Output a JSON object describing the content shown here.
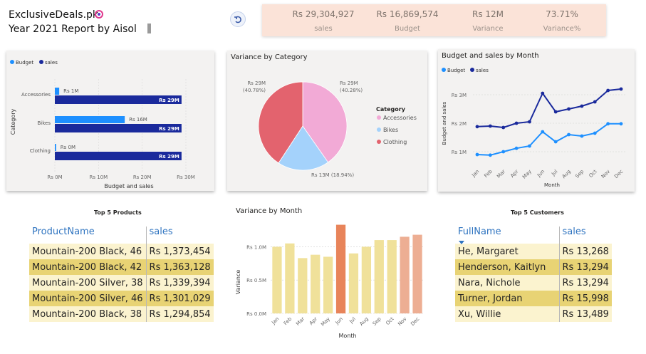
{
  "header": {
    "title": "ExclusiveDeals.pk",
    "subtitle": "Year 2021 Report by Aisol"
  },
  "kpis": [
    {
      "value": "Rs 29,304,927",
      "label": "sales"
    },
    {
      "value": "Rs 16,869,574",
      "label": "Budget"
    },
    {
      "value": "Rs 12M",
      "label": "Variance"
    },
    {
      "value": "73.71%",
      "label": "Variance%"
    }
  ],
  "colors": {
    "budget": "#1e90ff",
    "sales": "#1a2a9c",
    "kpi_bg": "#fbe3d8",
    "pie_accessories": "#f2aad6",
    "pie_bikes": "#a4d2fb",
    "pie_clothing": "#e3636e",
    "bar_light": "#f0e19a",
    "bar_dark": "#e8845a",
    "bar_mid": "#edae93",
    "row_light": "#fbf3cf",
    "row_dark": "#e8d374"
  },
  "chart_data": [
    {
      "type": "bar",
      "orientation": "horizontal",
      "title": "",
      "categories": [
        "Accessories",
        "Bikes",
        "Clothing"
      ],
      "series": [
        {
          "name": "Budget",
          "values": [
            1000000,
            16000000,
            0
          ],
          "labels": [
            "Rs 1M",
            "Rs 16M",
            "Rs 0M"
          ]
        },
        {
          "name": "sales",
          "values": [
            29000000,
            29000000,
            29000000
          ],
          "labels": [
            "Rs 29M",
            "Rs 29M",
            "Rs 29M"
          ]
        }
      ],
      "xlabel": "Budget and sales",
      "ylabel": "Category",
      "xlim": [
        0,
        30000000
      ],
      "xticks": [
        "Rs 0M",
        "Rs 10M",
        "Rs 20M",
        "Rs 30M"
      ],
      "legend": "top-left"
    },
    {
      "type": "pie",
      "title": "Variance by Category",
      "categories": [
        "Accessories",
        "Bikes",
        "Clothing"
      ],
      "values": [
        29,
        13,
        29
      ],
      "percents": [
        40.28,
        18.94,
        40.78
      ],
      "labels": [
        "Rs 29M (40.28%)",
        "Rs 13M (18.94%)",
        "Rs 29M (40.78%)"
      ],
      "legend_title": "Category",
      "legend": "right"
    },
    {
      "type": "line",
      "title": "Budget and sales by Month",
      "x": [
        "Jan",
        "Feb",
        "Mar",
        "Apr",
        "May",
        "Jun",
        "Jul",
        "Aug",
        "Sep",
        "Oct",
        "Nov",
        "Dec"
      ],
      "series": [
        {
          "name": "Budget",
          "values": [
            0.9,
            0.88,
            1.0,
            1.12,
            1.2,
            1.7,
            1.35,
            1.6,
            1.55,
            1.65,
            1.98,
            1.98
          ]
        },
        {
          "name": "sales",
          "values": [
            1.88,
            1.9,
            1.85,
            2.0,
            2.05,
            3.05,
            2.4,
            2.5,
            2.6,
            2.75,
            3.15,
            3.2
          ]
        }
      ],
      "ylabel": "Budget and sales",
      "xlabel": "Month",
      "ylim": [
        0.5,
        3.5
      ],
      "yticks": [
        "Rs 1M",
        "Rs 2M",
        "Rs 3M"
      ],
      "legend": "top-left"
    },
    {
      "type": "bar",
      "title": "Variance by Month",
      "categories": [
        "Jan",
        "Feb",
        "Mar",
        "Apr",
        "May",
        "Jun",
        "Jul",
        "Aug",
        "Sep",
        "Oct",
        "Nov",
        "Dec"
      ],
      "values": [
        1.0,
        1.05,
        0.83,
        0.88,
        0.85,
        1.33,
        0.9,
        1.0,
        1.1,
        1.1,
        1.15,
        1.18
      ],
      "ylabel": "Variance",
      "xlabel": "Month",
      "ylim": [
        0,
        1.4
      ],
      "yticks": [
        "Rs 0.0M",
        "Rs 0.5M",
        "Rs 1.0M"
      ]
    }
  ],
  "products": {
    "title": "Top 5 Products",
    "columns": [
      "ProductName",
      "sales"
    ],
    "rows": [
      [
        "Mountain-200 Black, 46",
        "Rs 1,373,454"
      ],
      [
        "Mountain-200 Black, 42",
        "Rs 1,363,128"
      ],
      [
        "Mountain-200 Silver, 38",
        "Rs 1,339,394"
      ],
      [
        "Mountain-200 Silver, 46",
        "Rs 1,301,029"
      ],
      [
        "Mountain-200 Black, 38",
        "Rs 1,294,854"
      ]
    ]
  },
  "customers": {
    "title": "Top 5 Customers",
    "columns": [
      "FullName",
      "sales"
    ],
    "rows": [
      [
        "He, Margaret",
        "Rs 13,268"
      ],
      [
        "Henderson, Kaitlyn",
        "Rs 13,294"
      ],
      [
        "Nara, Nichole",
        "Rs 13,294"
      ],
      [
        "Turner, Jordan",
        "Rs 15,998"
      ],
      [
        "Xu, Willie",
        "Rs 13,489"
      ]
    ]
  }
}
